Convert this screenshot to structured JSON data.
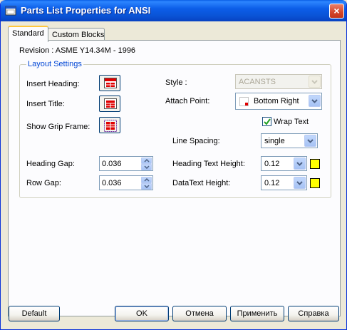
{
  "window": {
    "title": "Parts List Properties for ANSI",
    "close_label": "×"
  },
  "tabs": [
    {
      "label": "Standard",
      "active": true
    },
    {
      "label": "Custom Blocks",
      "active": false
    }
  ],
  "revision": "Revision : ASME Y14.34M - 1996",
  "layout": {
    "legend": "Layout Settings",
    "insert_heading": "Insert Heading:",
    "insert_title": "Insert Title:",
    "show_grip_frame": "Show Grip Frame:",
    "style_label": "Style :",
    "style_value": "ACANSTS",
    "attach_point_label": "Attach Point:",
    "attach_point_value": "Bottom Right",
    "wrap_text_label": "Wrap Text",
    "wrap_text_checked": true,
    "line_spacing_label": "Line Spacing:",
    "line_spacing_value": "single",
    "heading_gap_label": "Heading Gap:",
    "heading_gap_value": "0.036",
    "row_gap_label": "Row Gap:",
    "row_gap_value": "0.036",
    "heading_text_height_label": "Heading Text Height:",
    "heading_text_height_value": "0.12",
    "data_text_height_label": "DataText Height:",
    "data_text_height_value": "0.12",
    "swatch_color": "#ffff00"
  },
  "buttons": {
    "default": "Default",
    "ok": "OK",
    "cancel": "Отмена",
    "apply": "Применить",
    "help": "Справка"
  }
}
